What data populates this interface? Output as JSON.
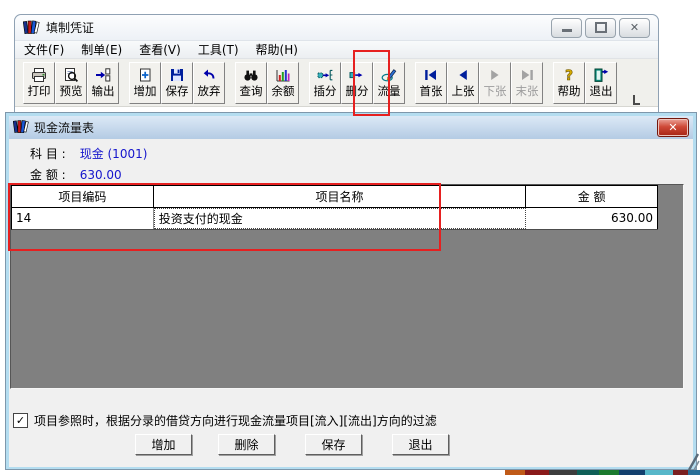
{
  "main_window": {
    "title": "填制凭证",
    "icon": "books-icon",
    "window_buttons": [
      {
        "key": "minimize",
        "icon": "minimize-icon"
      },
      {
        "key": "restore",
        "icon": "restore-icon"
      },
      {
        "key": "close",
        "icon": "close-icon",
        "glyph": "✕"
      }
    ],
    "menu_items": [
      {
        "key": "file",
        "label": "文件(F)"
      },
      {
        "key": "voucher",
        "label": "制单(E)"
      },
      {
        "key": "view",
        "label": "查看(V)"
      },
      {
        "key": "tools",
        "label": "工具(T)"
      },
      {
        "key": "help",
        "label": "帮助(H)"
      }
    ],
    "toolbar": {
      "groups": [
        {
          "buttons": [
            {
              "key": "print",
              "label": "打印",
              "icon": "printer-icon"
            },
            {
              "key": "preview",
              "label": "预览",
              "icon": "preview-icon"
            },
            {
              "key": "output",
              "label": "输出",
              "icon": "export-icon"
            }
          ]
        },
        {
          "buttons": [
            {
              "key": "add",
              "label": "增加",
              "icon": "add-doc-icon"
            },
            {
              "key": "save",
              "label": "保存",
              "icon": "save-icon"
            },
            {
              "key": "abandon",
              "label": "放弃",
              "icon": "undo-icon"
            }
          ]
        },
        {
          "buttons": [
            {
              "key": "query",
              "label": "查询",
              "icon": "binoculars-icon"
            },
            {
              "key": "balance",
              "label": "余额",
              "icon": "balance-chart-icon"
            }
          ]
        },
        {
          "buttons": [
            {
              "key": "insert-line",
              "label": "插分",
              "icon": "insert-line-icon"
            },
            {
              "key": "delete-line",
              "label": "删分",
              "icon": "delete-line-icon"
            },
            {
              "key": "cashflow",
              "label": "流量",
              "icon": "cashflow-pen-icon",
              "highlighted": true
            }
          ]
        },
        {
          "buttons": [
            {
              "key": "first",
              "label": "首张",
              "icon": "first-page-icon"
            },
            {
              "key": "prev",
              "label": "上张",
              "icon": "prev-page-icon"
            },
            {
              "key": "next",
              "label": "下张",
              "icon": "next-page-icon",
              "disabled": true
            },
            {
              "key": "last",
              "label": "末张",
              "icon": "last-page-icon",
              "disabled": true
            }
          ]
        },
        {
          "buttons": [
            {
              "key": "help",
              "label": "帮助",
              "icon": "help-icon"
            },
            {
              "key": "exit",
              "label": "退出",
              "icon": "exit-door-icon"
            }
          ]
        }
      ]
    }
  },
  "dialog": {
    "title": "现金流量表",
    "icon": "books-icon",
    "close_glyph": "✕",
    "fields": [
      {
        "key": "subject",
        "label": "科 目 :",
        "value": "现金 (1001)"
      },
      {
        "key": "amount",
        "label": "金 额 :",
        "value": "630.00"
      }
    ],
    "table": {
      "columns": [
        "项目编码",
        "项目名称",
        "金 额"
      ],
      "rows": [
        {
          "code": "14",
          "name": "投资支付的现金",
          "amount": "630.00"
        }
      ]
    },
    "checkbox": {
      "checked": true,
      "glyph": "✓",
      "label": "项目参照时，根据分录的借贷方向进行现金流量项目[流入][流出]方向的过滤"
    },
    "buttons": [
      {
        "key": "add",
        "label": "增加"
      },
      {
        "key": "delete",
        "label": "删除"
      },
      {
        "key": "save",
        "label": "保存"
      },
      {
        "key": "exit",
        "label": "退出"
      }
    ]
  },
  "annotations": {
    "highlight_color": "#e62020",
    "highlighted_items": [
      "toolbar-button-cashflow",
      "table-header-and-first-row"
    ]
  },
  "colors": {
    "value_text_blue": "#1515cc",
    "table_empty_gray": "#808080",
    "dialog_border_blue": "#b4ddf0",
    "close_button_red": "#c0392b"
  },
  "desktop_sliver_colors": [
    "#c05a18",
    "#8a1a1a",
    "#3d3d3d",
    "#0f5f57",
    "#1b7a2e",
    "#13406e",
    "#57b7c9",
    "#7a2020",
    "#2a6f98"
  ]
}
